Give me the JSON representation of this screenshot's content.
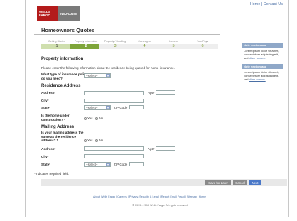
{
  "header": {
    "links": [
      "Home",
      "Contact Us"
    ],
    "logo_line1": "WELLS",
    "logo_line2": "FARGO",
    "logo_insurance": "INSURANCE"
  },
  "page_title": "Homeowners Quotes",
  "steps": [
    {
      "label": "Getting Started",
      "num": "1"
    },
    {
      "label": "Property Information",
      "num": "2"
    },
    {
      "label": "Property / Dwelling",
      "num": "3"
    },
    {
      "label": "Coverages",
      "num": "4"
    },
    {
      "label": "Losses",
      "num": "5"
    },
    {
      "label": "Your Pays",
      "num": "6"
    }
  ],
  "sidebar": [
    {
      "heading": "Note section and",
      "body": "Lorem ipsum dolor sit amet, consectetuer adipiscing elit, sed",
      "link": "diam nonum."
    },
    {
      "heading": "Note section and",
      "body": "Lorem ipsum dolor sit amet, consectetuer adipiscing elit, sed",
      "link": "diam nonum."
    }
  ],
  "form": {
    "section_title": "Property information",
    "intro": "Please enter the following information about the residence being quoted for home insurance.",
    "insurance_type_label": "What type of insurance policy do you need?",
    "select_default": "--select--",
    "residence_heading": "Residence Address",
    "address_label": "Address*",
    "apt_label": "Apt#",
    "city_label": "City*",
    "state_label": "State*",
    "zip_label": "ZIP Code",
    "construction_label": "Is the home under construction? *",
    "yes": "Yes",
    "no": "No",
    "mailing_heading": "Mailing Address",
    "mailing_same_label": "Is your mailing address the same as the residence address? *",
    "mail_address_label": "Address*",
    "mail_apt_label": "Apt#",
    "mail_city_label": "City*",
    "mail_state_label": "State*",
    "mail_zip_label": "ZIP Code"
  },
  "footnote": "*Indicates required field.",
  "buttons": {
    "save": "Save for Later",
    "cancel": "Cancel",
    "next": "Next"
  },
  "footer": {
    "links": "About Wells Fargo | Careers | Privacy, Security & Legal | Report Email Fraud | Sitemap | Home",
    "copyright": "© 1999 - 2010 Wells Fargo. All rights reserved."
  }
}
